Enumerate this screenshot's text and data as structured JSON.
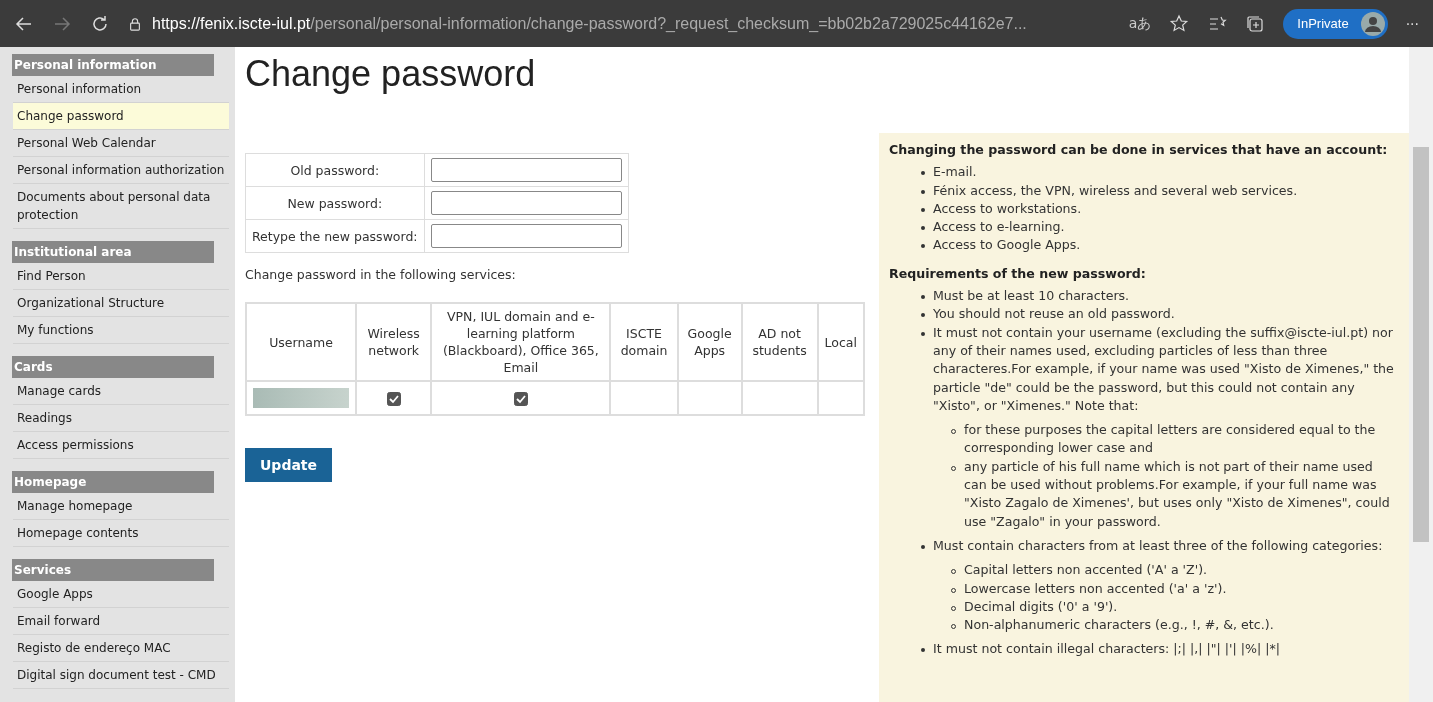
{
  "browser": {
    "url_host": "https://fenix.iscte-iul.pt",
    "url_path": "/personal/personal-information/change-password?_request_checksum_=bb02b2a729025c44162e7...",
    "read_aloud": "aあ",
    "inprivate": "InPrivate",
    "more": "···"
  },
  "sidebar": [
    {
      "title": "Personal information",
      "items": [
        {
          "label": "Personal information",
          "selected": false
        },
        {
          "label": "Change password",
          "selected": true
        },
        {
          "label": "Personal Web Calendar",
          "selected": false
        },
        {
          "label": "Personal information authorization",
          "selected": false
        },
        {
          "label": "Documents about personal data protection",
          "selected": false
        }
      ]
    },
    {
      "title": "Institutional area",
      "items": [
        {
          "label": "Find Person",
          "selected": false
        },
        {
          "label": "Organizational Structure",
          "selected": false
        },
        {
          "label": "My functions",
          "selected": false
        }
      ]
    },
    {
      "title": "Cards",
      "items": [
        {
          "label": "Manage cards",
          "selected": false
        },
        {
          "label": "Readings",
          "selected": false
        },
        {
          "label": "Access permissions",
          "selected": false
        }
      ]
    },
    {
      "title": "Homepage",
      "items": [
        {
          "label": "Manage homepage",
          "selected": false
        },
        {
          "label": "Homepage contents",
          "selected": false
        }
      ]
    },
    {
      "title": "Services",
      "items": [
        {
          "label": "Google Apps",
          "selected": false
        },
        {
          "label": "Email forward",
          "selected": false
        },
        {
          "label": "Registo de endereço MAC",
          "selected": false
        },
        {
          "label": "Digital sign document test - CMD",
          "selected": false
        }
      ]
    }
  ],
  "title": "Change password",
  "form": [
    {
      "label": "Old password:"
    },
    {
      "label": "New password:"
    },
    {
      "label": "Retype the new password:"
    }
  ],
  "services_caption": "Change password in the following services:",
  "services": {
    "columns": [
      "Username",
      "Wireless network",
      "VPN, IUL domain and e-learning platform (Blackboard), Office 365, Email",
      "ISCTE domain",
      "Google Apps",
      "AD not students",
      "Local"
    ],
    "row": [
      {
        "kind": "blurred"
      },
      {
        "kind": "checkbox",
        "checked": true
      },
      {
        "kind": "checkbox",
        "checked": true
      },
      {
        "kind": "empty"
      },
      {
        "kind": "empty"
      },
      {
        "kind": "empty"
      },
      {
        "kind": "empty"
      }
    ]
  },
  "update_button": "Update",
  "info": {
    "heading1": "Changing the password can be done in services that have an account:",
    "services": [
      "E-mail.",
      "Fénix access, the VPN, wireless and several web services.",
      "Access to workstations.",
      "Access to e-learning.",
      "Access to Google Apps."
    ],
    "heading2": "Requirements of the new password:",
    "requirements": [
      {
        "text": "Must be at least 10 characters."
      },
      {
        "text": "You should not reuse an old password."
      },
      {
        "text": "It must not contain your username (excluding the suffix@iscte-iul.pt) nor any of their names used, excluding particles of less than three characteres.For example, if your name was used \"Xisto de Ximenes,\" the particle \"de\" could be the password, but this could not contain any \"Xisto\", or \"Ximenes.\" Note that:",
        "children": [
          "for these purposes the capital letters are considered equal to the corresponding lower case and",
          "any particle of his full name which is not part of their name used can be used without problems.For example, if your full name was \"Xisto Zagalo de Ximenes', but uses only \"Xisto de Ximenes\", could use \"Zagalo\" in your password."
        ]
      },
      {
        "text": "Must contain characters from at least three of the following categories:",
        "children": [
          "Capital letters non accented ('A' a 'Z').",
          "Lowercase letters non accented ('a' a 'z').",
          "Decimal digits ('0' a '9').",
          "Non-alphanumeric characters (e.g., !, #, &, etc.)."
        ]
      },
      {
        "text": "It must not contain illegal characters: |;| |,| |\"| |'| |%| |*|"
      }
    ]
  }
}
